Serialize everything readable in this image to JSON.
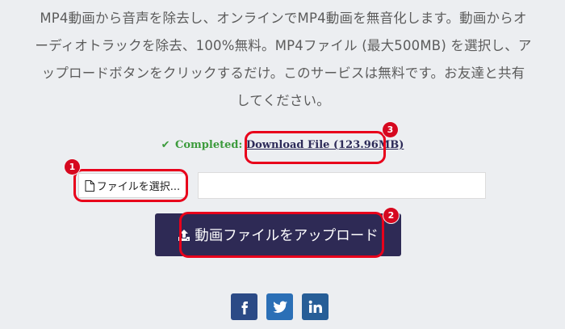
{
  "description": {
    "line1": "MP4動画から音声を除去し、オンラインでMP4動画を無音化します。動画からオ",
    "line2": "ーディオトラックを除去、100%無料。MP4ファイル (最大500MB) を選択し、ア",
    "line3": "ップロードボタンをクリックするだけ。このサービスは無料です。お友達と共有",
    "line4": "してください。"
  },
  "status": {
    "completed_label": "Completed:",
    "download_link": "Download File (123.96MB)"
  },
  "file_input": {
    "button_label": "ファイルを選択...",
    "file_name_value": ""
  },
  "upload": {
    "button_label": "動画ファイルをアップロード"
  },
  "annotations": {
    "badge_1": "1",
    "badge_2": "2",
    "badge_3": "3",
    "color": "#e8001b"
  },
  "social": {
    "icons": [
      "facebook-icon",
      "twitter-icon",
      "linkedin-icon"
    ]
  },
  "colors": {
    "page_bg": "#eceef1",
    "upload_button_bg": "#2e2a55",
    "completed_green": "#3c9b3c",
    "link_color": "#2c2a58"
  }
}
